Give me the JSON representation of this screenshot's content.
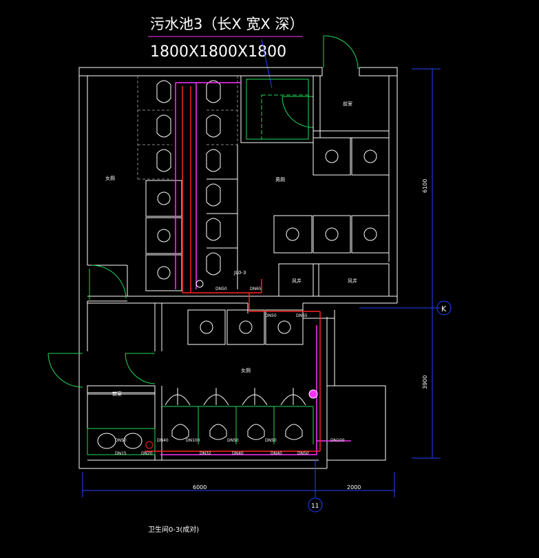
{
  "annotation": {
    "line1": "污水池3（长X 宽X 深）",
    "line2": "1800X1800X1800"
  },
  "rooms": {
    "front_room": "前室",
    "female_toilet": "女厕",
    "male_toilet_top": "男厕",
    "male_toilet_bottom": "女厕",
    "front_room_left": "前室",
    "shaft_1": "风井",
    "shaft_2": "风井"
  },
  "pipe_labels": {
    "jl": "JL0-3",
    "dn50_a": "DN50",
    "dn65_a": "DN65",
    "dn50_b": "DN50",
    "dn50_c": "DN50",
    "dn40_a": "DN40",
    "dn50_d": "DN50",
    "dn65_b": "DN65",
    "dn50_e": "DN50",
    "dn15": "DN15",
    "dn20": "DN20",
    "dn32": "DN32",
    "dn40_b": "DN40",
    "dn40_c": "DN40",
    "dn50_f": "DN50",
    "dn100": "DN100",
    "dn100_b": "DN100"
  },
  "dimensions": {
    "right_top": "6100",
    "right_bottom": "3900",
    "bottom_left": "6000",
    "bottom_right": "2000"
  },
  "axis": {
    "k": "K",
    "n11": "11"
  },
  "caption": "卫生间0-3(成对)",
  "colors": {
    "background": "#000000",
    "wall": "#ffffff",
    "fixture": "#22dd55",
    "pipe_red": "#ff2222",
    "pipe_magenta": "#ff33ff",
    "dimension_blue": "#2244ff"
  }
}
